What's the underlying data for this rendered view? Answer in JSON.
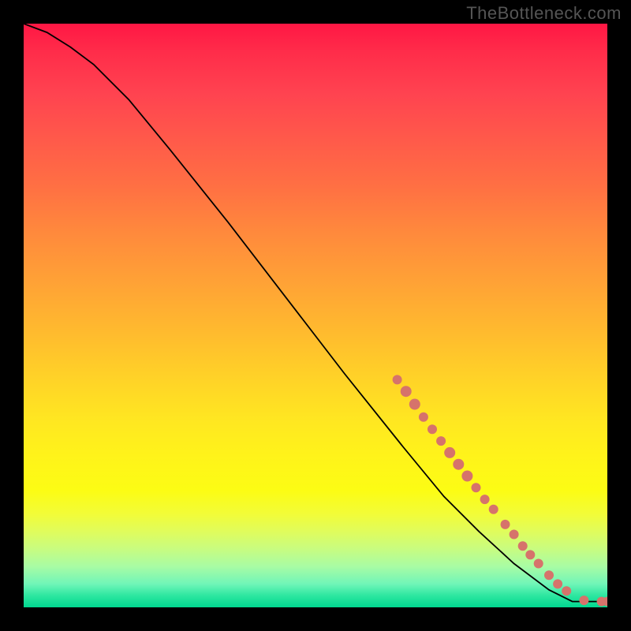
{
  "attribution": "TheBottleneck.com",
  "chart_data": {
    "type": "line",
    "title": "",
    "xlabel": "",
    "ylabel": "",
    "xlim": [
      0,
      100
    ],
    "ylim": [
      0,
      100
    ],
    "curve": [
      {
        "x": 0,
        "y": 100
      },
      {
        "x": 4,
        "y": 98.5
      },
      {
        "x": 8,
        "y": 96
      },
      {
        "x": 12,
        "y": 93
      },
      {
        "x": 18,
        "y": 87
      },
      {
        "x": 25,
        "y": 78.5
      },
      {
        "x": 35,
        "y": 66
      },
      {
        "x": 45,
        "y": 53
      },
      {
        "x": 55,
        "y": 40
      },
      {
        "x": 65,
        "y": 27.5
      },
      {
        "x": 72,
        "y": 19
      },
      {
        "x": 78,
        "y": 13
      },
      {
        "x": 84,
        "y": 7.5
      },
      {
        "x": 90,
        "y": 3
      },
      {
        "x": 94,
        "y": 1
      },
      {
        "x": 100,
        "y": 1
      }
    ],
    "points": [
      {
        "x": 64,
        "y": 39,
        "r": 6
      },
      {
        "x": 65.5,
        "y": 37,
        "r": 7
      },
      {
        "x": 67,
        "y": 34.8,
        "r": 7
      },
      {
        "x": 68.5,
        "y": 32.6,
        "r": 6
      },
      {
        "x": 70,
        "y": 30.5,
        "r": 6
      },
      {
        "x": 71.5,
        "y": 28.5,
        "r": 6
      },
      {
        "x": 73,
        "y": 26.5,
        "r": 7
      },
      {
        "x": 74.5,
        "y": 24.5,
        "r": 7
      },
      {
        "x": 76,
        "y": 22.5,
        "r": 7
      },
      {
        "x": 77.5,
        "y": 20.5,
        "r": 6
      },
      {
        "x": 79,
        "y": 18.5,
        "r": 6
      },
      {
        "x": 80.5,
        "y": 16.8,
        "r": 6
      },
      {
        "x": 82.5,
        "y": 14.2,
        "r": 6
      },
      {
        "x": 84,
        "y": 12.5,
        "r": 6
      },
      {
        "x": 85.5,
        "y": 10.5,
        "r": 6
      },
      {
        "x": 86.8,
        "y": 9,
        "r": 6
      },
      {
        "x": 88.2,
        "y": 7.5,
        "r": 6
      },
      {
        "x": 90,
        "y": 5.5,
        "r": 6
      },
      {
        "x": 91.5,
        "y": 4,
        "r": 6
      },
      {
        "x": 93,
        "y": 2.8,
        "r": 6
      },
      {
        "x": 96,
        "y": 1.2,
        "r": 6
      },
      {
        "x": 99,
        "y": 1,
        "r": 6
      },
      {
        "x": 100,
        "y": 1,
        "r": 6
      }
    ]
  }
}
